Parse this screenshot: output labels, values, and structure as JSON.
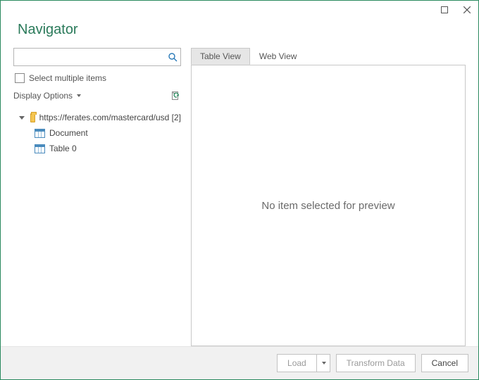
{
  "window": {
    "title": "Navigator"
  },
  "search": {
    "placeholder": ""
  },
  "checkbox": {
    "label": "Select multiple items"
  },
  "display_options": {
    "label": "Display Options"
  },
  "tree": {
    "root": {
      "label": "https://ferates.com/mastercard/usd [2]"
    },
    "items": [
      {
        "label": "Document"
      },
      {
        "label": "Table 0"
      }
    ]
  },
  "tabs": {
    "table": "Table View",
    "web": "Web View"
  },
  "preview": {
    "empty_message": "No item selected for preview"
  },
  "buttons": {
    "load": "Load",
    "transform": "Transform Data",
    "cancel": "Cancel"
  }
}
